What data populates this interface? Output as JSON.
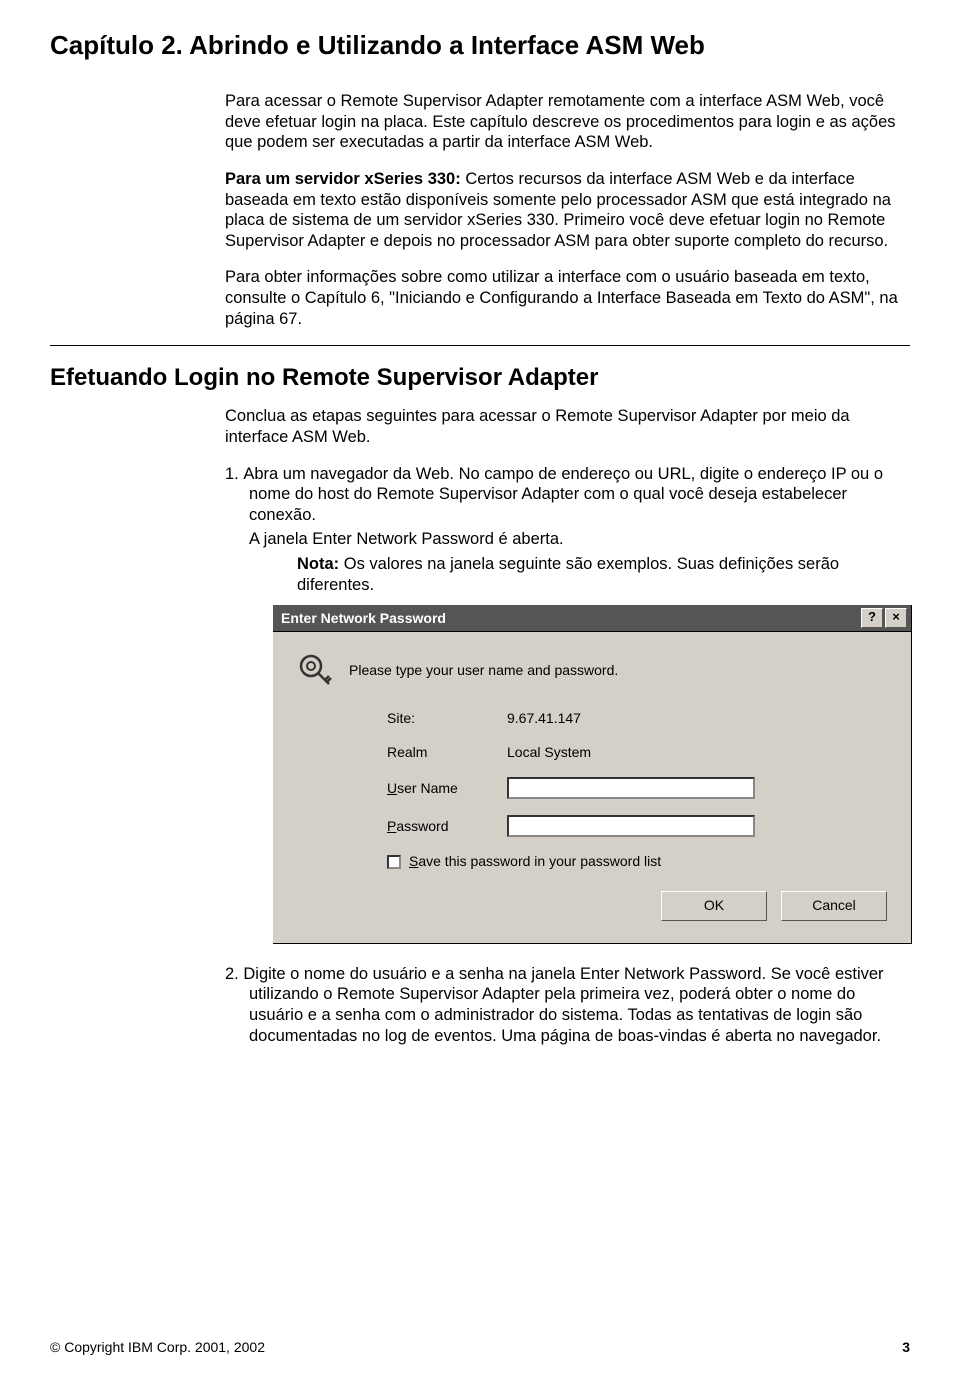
{
  "chapter": {
    "title": "Capítulo 2. Abrindo e Utilizando a Interface ASM Web"
  },
  "intro": {
    "p1": "Para acessar o Remote Supervisor Adapter remotamente com a interface ASM Web, você deve efetuar login na placa. Este capítulo descreve os procedimentos para login e as ações que podem ser executadas a partir da interface ASM Web.",
    "p2_prefix": "Para um servidor xSeries 330:",
    "p2_body": " Certos recursos da interface ASM Web e da interface baseada em texto estão disponíveis somente pelo processador ASM que está integrado na placa de sistema de um servidor xSeries 330. Primeiro você deve efetuar login no Remote Supervisor Adapter e depois no processador ASM para obter suporte completo do recurso.",
    "p3": "Para obter informações sobre como utilizar a interface com o usuário baseada em texto, consulte o Capítulo 6, \"Iniciando e Configurando a Interface Baseada em Texto do ASM\", na página 67."
  },
  "section": {
    "title": "Efetuando Login no Remote Supervisor Adapter",
    "lead": "Conclua as etapas seguintes para acessar o Remote Supervisor Adapter por meio da interface ASM Web.",
    "step1_num": "1.",
    "step1": "Abra um navegador da Web. No campo de endereço ou URL, digite o endereço IP ou o nome do host do Remote Supervisor Adapter com o qual você deseja estabelecer conexão.",
    "step1b": "A janela Enter Network Password é aberta.",
    "note_label": "Nota:",
    "note_text": " Os valores na janela seguinte são exemplos. Suas definições serão diferentes.",
    "step2_num": "2.",
    "step2": "Digite o nome do usuário e a senha na janela Enter Network Password. Se você estiver utilizando o Remote Supervisor Adapter pela primeira vez, poderá obter o nome do usuário e a senha com o administrador do sistema. Todas as tentativas de login são documentadas no log de eventos. Uma página de boas-vindas é aberta no navegador."
  },
  "dialog": {
    "title": "Enter Network Password",
    "help_btn": "?",
    "close_btn": "×",
    "prompt": "Please type your user name and password.",
    "site_label": "Site:",
    "site_value": "9.67.41.147",
    "realm_label": "Realm",
    "realm_value": "Local System",
    "user_label_pre": "U",
    "user_label": "ser Name",
    "pass_label_pre": "P",
    "pass_label": "assword",
    "save_label_pre": "S",
    "save_label": "ave this password in your password list",
    "ok_btn": "OK",
    "cancel_btn": "Cancel"
  },
  "footer": {
    "copyright": "© Copyright IBM Corp. 2001, 2002",
    "page": "3"
  }
}
